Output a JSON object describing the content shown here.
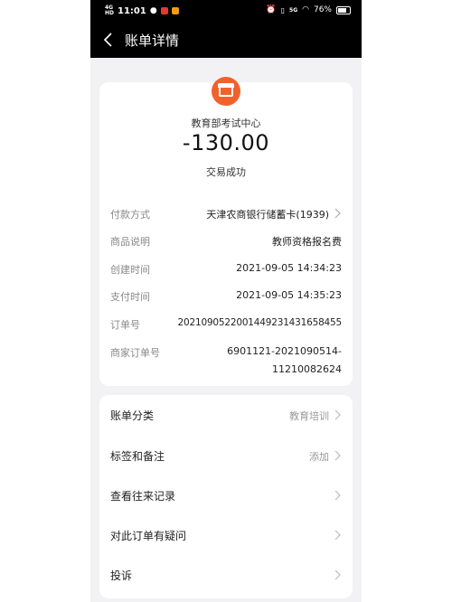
{
  "status_bar": {
    "network_top": "4G",
    "network_bottom": "HD",
    "time": "11:01",
    "right_network": "5G",
    "battery": "76%",
    "battery_level": 0.76
  },
  "header": {
    "title": "账单详情"
  },
  "summary": {
    "merchant": "教育部考试中心",
    "amount": "-130.00",
    "status": "交易成功"
  },
  "details": [
    {
      "label": "付款方式",
      "value": "天津农商银行储蓄卡(1939)"
    },
    {
      "label": "商品说明",
      "value": "教师资格报名费"
    },
    {
      "label": "创建时间",
      "value": "2021-09-05 14:34:23"
    },
    {
      "label": "支付时间",
      "value": "2021-09-05 14:35:23"
    },
    {
      "label": "订单号",
      "value": "20210905220014492314316584 55"
    },
    {
      "label": "商家订单号",
      "value_line1": "6901121-2021090514-",
      "value_line2": "11210082624"
    }
  ],
  "actions": [
    {
      "label": "账单分类",
      "value": "教育培训"
    },
    {
      "label": "标签和备注",
      "value": "添加"
    },
    {
      "label": "查看往来记录",
      "value": ""
    },
    {
      "label": "对此订单有疑问",
      "value": ""
    },
    {
      "label": "投诉",
      "value": ""
    }
  ],
  "colors": {
    "accent": "#f0622d",
    "header_bg": "#000000",
    "page_bg": "#f2f2f4"
  }
}
